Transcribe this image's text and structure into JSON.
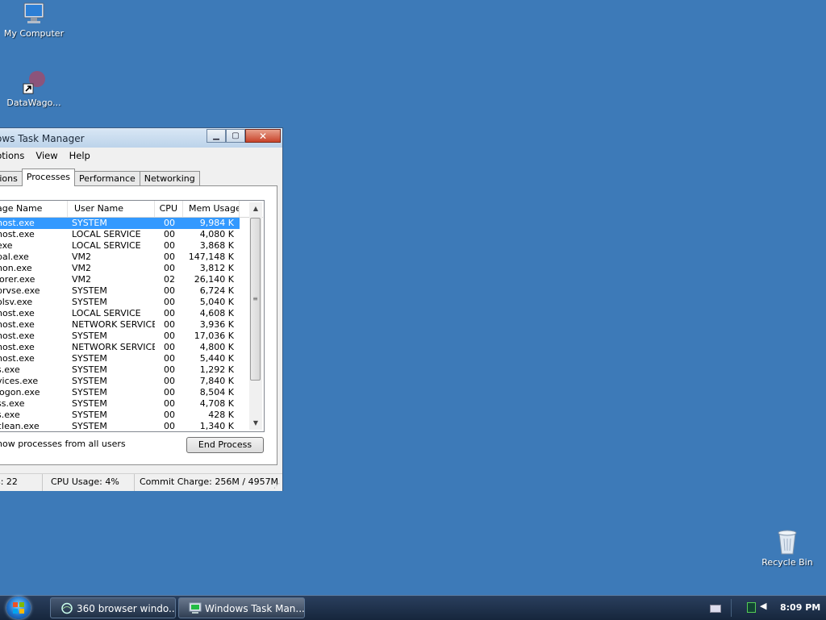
{
  "desktop": {
    "icons": [
      {
        "label": "My Computer"
      },
      {
        "label": "DataWago..."
      },
      {
        "label": "Recycle Bin"
      }
    ]
  },
  "window": {
    "title": "ows Task Manager",
    "menu": [
      "ptions",
      "View",
      "Help"
    ],
    "tabs": [
      "tions",
      "Processes",
      "Performance",
      "Networking"
    ],
    "active_tab": "Processes",
    "columns": {
      "image": "age Name",
      "user": "User Name",
      "cpu": "CPU",
      "mem": "Mem Usage"
    },
    "processes": [
      {
        "image": "host.exe",
        "user": "SYSTEM",
        "cpu": "00",
        "mem": "9,984 K",
        "selected": true
      },
      {
        "image": "host.exe",
        "user": "LOCAL SERVICE",
        "cpu": "00",
        "mem": "4,080 K"
      },
      {
        "image": "exe",
        "user": "LOCAL SERVICE",
        "cpu": "00",
        "mem": "3,868 K"
      },
      {
        "image": "pal.exe",
        "user": "VM2",
        "cpu": "00",
        "mem": "147,148 K"
      },
      {
        "image": "non.exe",
        "user": "VM2",
        "cpu": "00",
        "mem": "3,812 K"
      },
      {
        "image": "lorer.exe",
        "user": "VM2",
        "cpu": "02",
        "mem": "26,140 K"
      },
      {
        "image": "prvse.exe",
        "user": "SYSTEM",
        "cpu": "00",
        "mem": "6,724 K"
      },
      {
        "image": "olsv.exe",
        "user": "SYSTEM",
        "cpu": "00",
        "mem": "5,040 K"
      },
      {
        "image": "host.exe",
        "user": "LOCAL SERVICE",
        "cpu": "00",
        "mem": "4,608 K"
      },
      {
        "image": "host.exe",
        "user": "NETWORK SERVICE",
        "cpu": "00",
        "mem": "3,936 K"
      },
      {
        "image": "host.exe",
        "user": "SYSTEM",
        "cpu": "00",
        "mem": "17,036 K"
      },
      {
        "image": "host.exe",
        "user": "NETWORK SERVICE",
        "cpu": "00",
        "mem": "4,800 K"
      },
      {
        "image": "host.exe",
        "user": "SYSTEM",
        "cpu": "00",
        "mem": "5,440 K"
      },
      {
        "image": "s.exe",
        "user": "SYSTEM",
        "cpu": "00",
        "mem": "1,292 K"
      },
      {
        "image": "vices.exe",
        "user": "SYSTEM",
        "cpu": "00",
        "mem": "7,840 K"
      },
      {
        "image": "logon.exe",
        "user": "SYSTEM",
        "cpu": "00",
        "mem": "8,504 K"
      },
      {
        "image": "ss.exe",
        "user": "SYSTEM",
        "cpu": "00",
        "mem": "4,708 K"
      },
      {
        "image": "s.exe",
        "user": "SYSTEM",
        "cpu": "00",
        "mem": "428 K"
      },
      {
        "image": "clean.exe",
        "user": "SYSTEM",
        "cpu": "00",
        "mem": "1,340 K"
      }
    ],
    "show_all_label": "how processes from all users",
    "end_process_label": "End Process",
    "status": {
      "processes": "s: 22",
      "cpu": "CPU Usage: 4%",
      "commit": "Commit Charge: 256M / 4957M"
    }
  },
  "taskbar": {
    "buttons": [
      {
        "label": "360 browser windo...",
        "icon": "browser-icon"
      },
      {
        "label": "Windows Task Man...",
        "icon": "task-manager-icon",
        "active": true
      }
    ],
    "clock": "8:09 PM"
  },
  "colors": {
    "desktop": "#3d7ab8",
    "selection": "#3399ff",
    "taskbar": "#1c2e48"
  }
}
